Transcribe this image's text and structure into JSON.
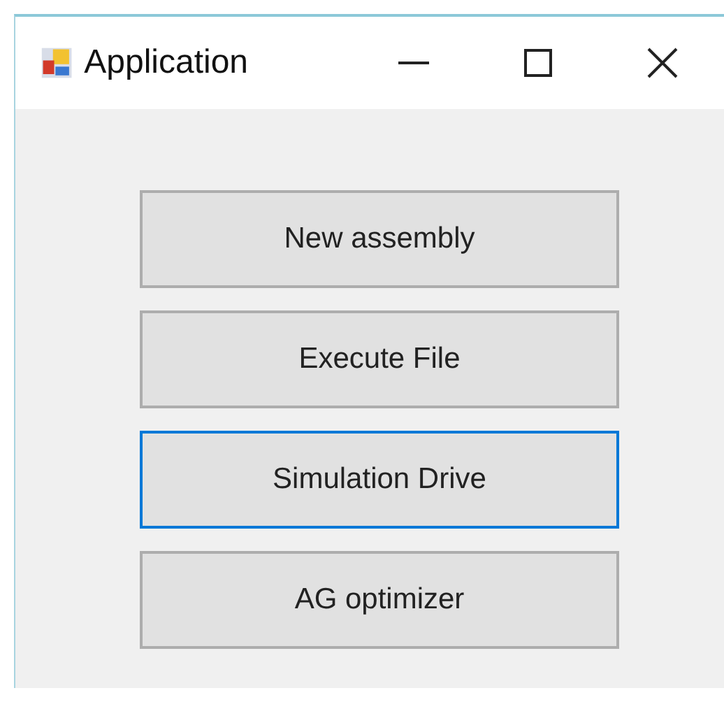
{
  "window": {
    "title": "Application"
  },
  "buttons": [
    {
      "label": "New assembly",
      "focused": false
    },
    {
      "label": "Execute File",
      "focused": false
    },
    {
      "label": "Simulation Drive",
      "focused": true
    },
    {
      "label": "AG optimizer",
      "focused": false
    }
  ]
}
